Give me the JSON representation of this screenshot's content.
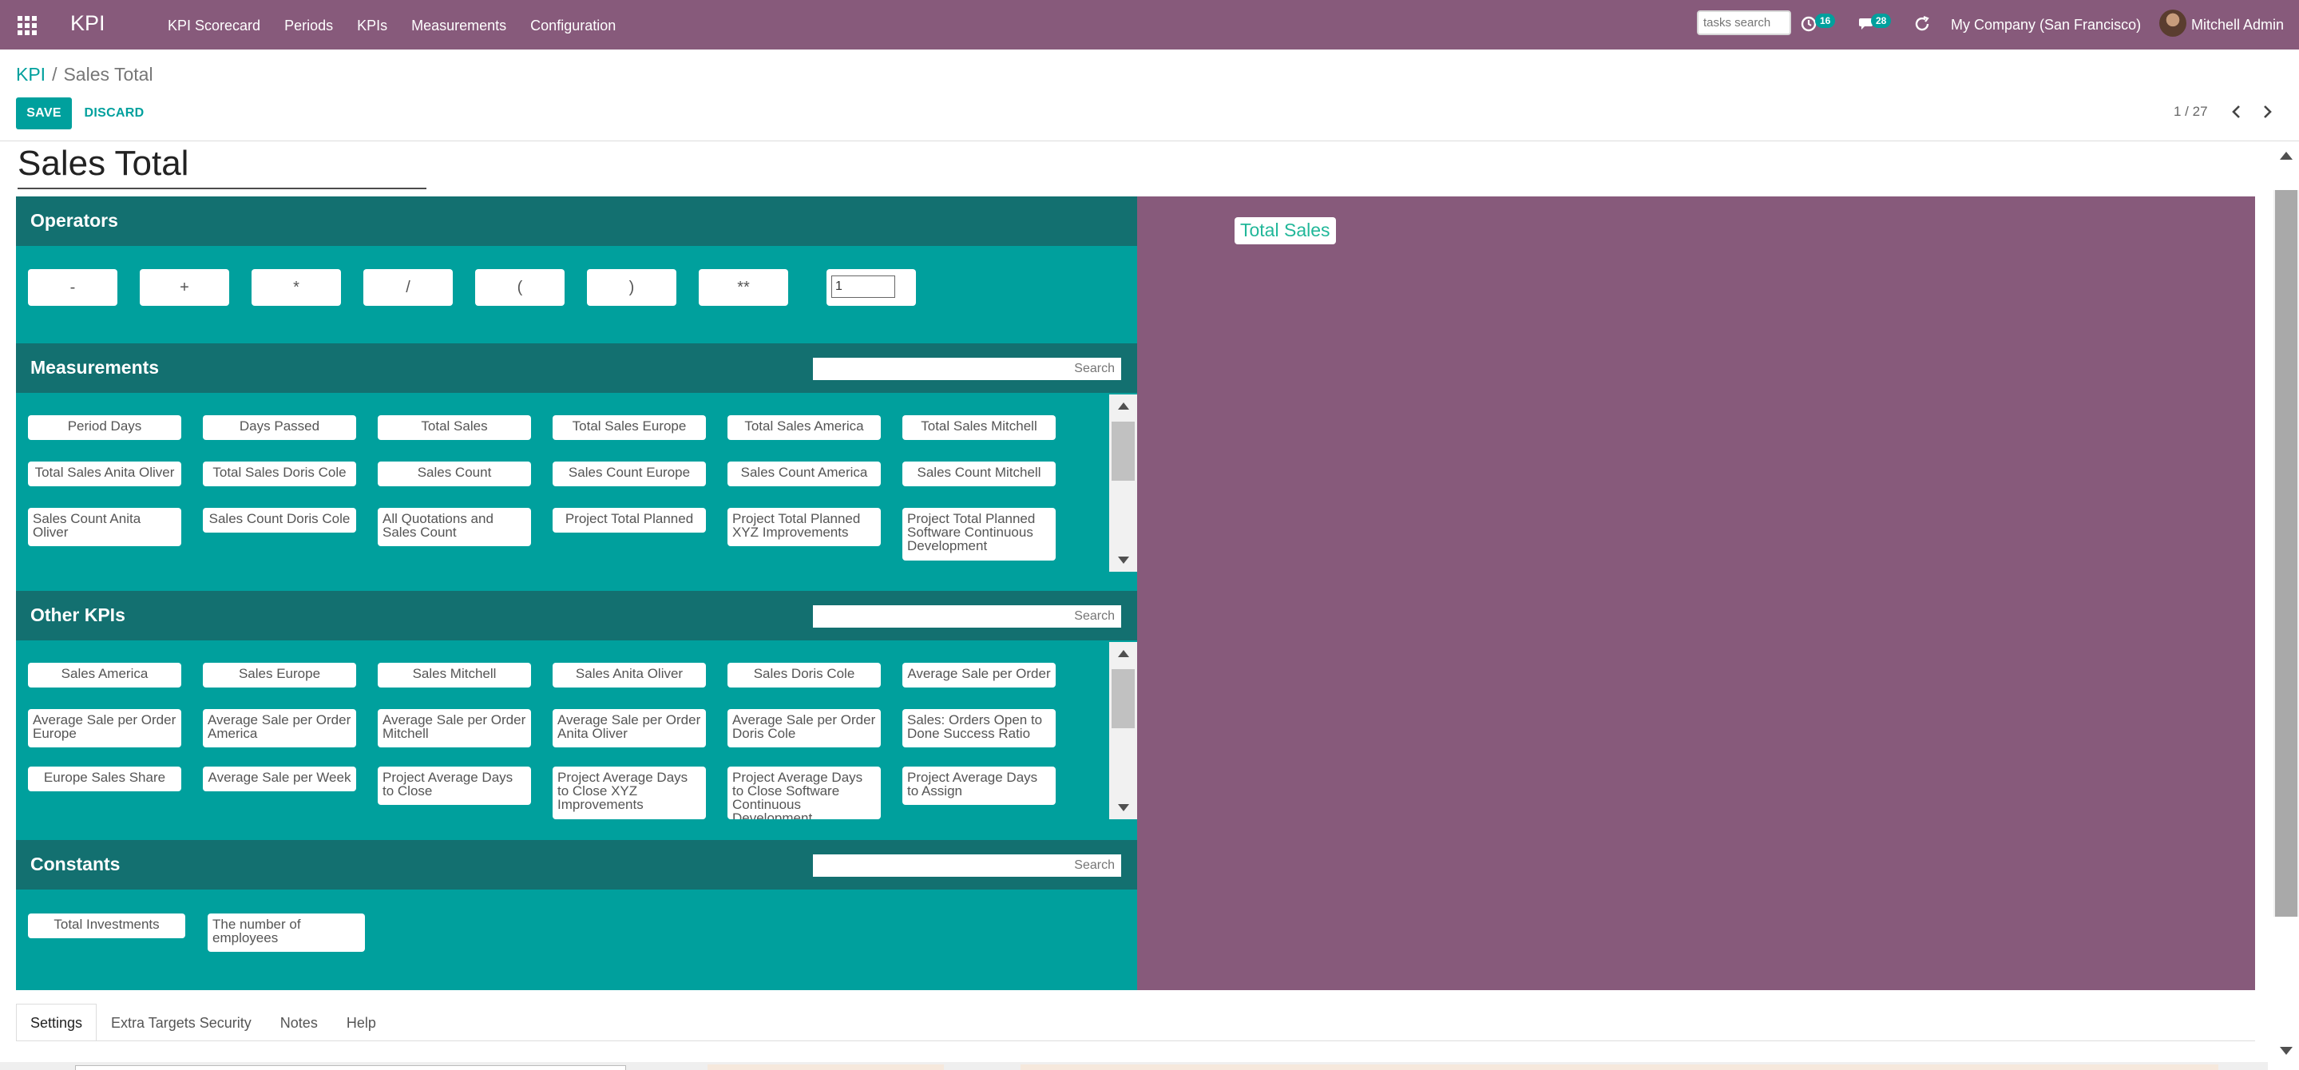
{
  "navbar": {
    "brand": "KPI",
    "menu": [
      "KPI Scorecard",
      "Periods",
      "KPIs",
      "Measurements",
      "Configuration"
    ],
    "task_search_placeholder": "tasks search",
    "activity_count": "16",
    "message_count": "28",
    "company": "My Company (San Francisco)",
    "user": "Mitchell Admin"
  },
  "breadcrumb": {
    "parent": "KPI",
    "separator": "/",
    "current": "Sales Total"
  },
  "controls": {
    "save": "SAVE",
    "discard": "DISCARD",
    "pager": "1 / 27"
  },
  "form": {
    "title": "Sales Total",
    "result_chip": "Total Sales"
  },
  "operators": {
    "title": "Operators",
    "buttons": [
      "-",
      "+",
      "*",
      "/",
      "(",
      ")",
      "**"
    ],
    "number_value": "1"
  },
  "measurements": {
    "title": "Measurements",
    "search_placeholder": "Search",
    "items": [
      "Period Days",
      "Days Passed",
      "Total Sales",
      "Total Sales Europe",
      "Total Sales America",
      "Total Sales Mitchell",
      "Total Sales Anita Oliver",
      "Total Sales Doris Cole",
      "Sales Count",
      "Sales Count Europe",
      "Sales Count America",
      "Sales Count Mitchell",
      "Sales Count Anita Oliver",
      "Sales Count Doris Cole",
      "All Quotations and Sales Count",
      "Project Total Planned",
      "Project Total Planned XYZ Improvements",
      "Project Total Planned Software Continuous Development"
    ]
  },
  "other_kpis": {
    "title": "Other KPIs",
    "search_placeholder": "Search",
    "items": [
      "Sales America",
      "Sales Europe",
      "Sales Mitchell",
      "Sales Anita Oliver",
      "Sales Doris Cole",
      "Average Sale per Order",
      "Average Sale per Order Europe",
      "Average Sale per Order America",
      "Average Sale per Order Mitchell",
      "Average Sale per Order Anita Oliver",
      "Average Sale per Order Doris Cole",
      "Sales: Orders Open to Done Success Ratio",
      "Europe Sales Share",
      "Average Sale per Week",
      "Project Average Days to Close",
      "Project Average Days to Close XYZ Improvements",
      "Project Average Days to Close Software Continuous Development",
      "Project Average Days to Assign"
    ]
  },
  "constants": {
    "title": "Constants",
    "search_placeholder": "Search",
    "items": [
      "Total Investments",
      "The number of employees"
    ]
  },
  "tabs": [
    "Settings",
    "Extra Targets Security",
    "Notes",
    "Help"
  ],
  "colors": {
    "navbar": "#875a7b",
    "accent": "#00a09d",
    "section_header": "#137070",
    "result_panel": "#875a7b",
    "result_text": "#21b799"
  }
}
